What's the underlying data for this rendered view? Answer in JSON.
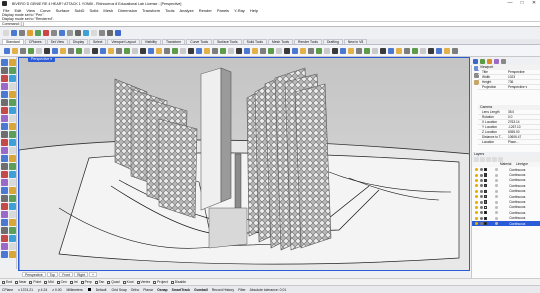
{
  "title": "BIVERO D GENIE RE 4 HEAR? ATTACK 1 YONBI - Rhinoceros 8 Educational Lab License - [Perspective]",
  "menu": [
    "File",
    "Edit",
    "View",
    "Curve",
    "Surface",
    "SubD",
    "Solid",
    "Mesh",
    "Dimension",
    "Transform",
    "Tools",
    "Analyze",
    "Render",
    "Panels",
    "Y-Ray",
    "Help"
  ],
  "command_history": [
    "Display mode set to \"Pen\".",
    "Display mode set to \"Rendered\"."
  ],
  "command_prompt": "Command: [ ]",
  "tabs": [
    "Standard",
    "CPlanes",
    "Set View",
    "Display",
    "Select",
    "Viewport Layout",
    "Visibility",
    "Transform",
    "Curve Tools",
    "Surface Tools",
    "Solid Tools",
    "Mesh Tools",
    "Render Tools",
    "Drafting",
    "New in V8"
  ],
  "viewport": {
    "label": "Perspective ▾"
  },
  "viewport_tabs": [
    "Perspective",
    "Top",
    "Front",
    "Right",
    "+"
  ],
  "osnaps": [
    "End",
    "Near",
    "Point",
    "Mid",
    "Cen",
    "Int",
    "Perp",
    "Tan",
    "Quad",
    "Knot",
    "Vertex",
    "Project",
    "Disable"
  ],
  "status": {
    "cplane": "CPlane",
    "x": "x 1374.21",
    "y": "y 4.24",
    "z": "z 0.00",
    "units": "Millimeters",
    "layer": "Default",
    "items": [
      "Grid Snap",
      "Ortho",
      "Planar",
      "Osnap",
      "SmartTrack",
      "Gumball",
      "Record History",
      "Filter",
      "Absolute tolerance: 0.01"
    ],
    "bold_items": [
      "Osnap",
      "SmartTrack",
      "Gumball"
    ]
  },
  "properties": {
    "viewport_header": "Viewport",
    "title_k": "Title",
    "title_v": "Perspective",
    "width_k": "Width",
    "width_v": "1023",
    "height_k": "Height",
    "height_v": "736",
    "projection_k": "Projection",
    "projection_v": "Perspective ▾",
    "camera_header": "Camera",
    "lens_k": "Lens Length",
    "lens_v": "35.0",
    "rotation_k": "Rotation",
    "rotation_v": "0.0",
    "xloc_k": "X Location",
    "xloc_v": "2763.14",
    "yloc_k": "Y Location",
    "yloc_v": "-1267.10",
    "zloc_k": "Z Location",
    "zloc_v": "6055.00",
    "dist_k": "Distance to T...",
    "dist_v": "10606.47",
    "location_k": "Location",
    "location_v": "Place..."
  },
  "layers": {
    "header": "Layers",
    "col_material": "Material",
    "col_linetype": "Linetype",
    "linetype": "Continuous",
    "rows": 11,
    "colors": [
      "#000000",
      "#c00000",
      "#800080",
      "#00a000",
      "#2040ff",
      "#00c0c0",
      "#ff00ff",
      "#ffffff",
      "#000000",
      "#000000",
      "#000000"
    ]
  }
}
